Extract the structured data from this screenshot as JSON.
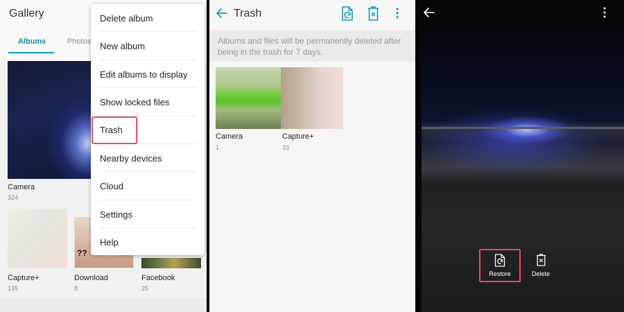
{
  "gallery": {
    "title": "Gallery",
    "tabs": [
      {
        "label": "Albums",
        "active": true
      },
      {
        "label": "Photos",
        "active": false
      }
    ],
    "albums": [
      {
        "name": "Camera",
        "count": "324"
      },
      {
        "name": "Capture+",
        "count": "135"
      },
      {
        "name": "Download",
        "count": "8"
      },
      {
        "name": "Facebook",
        "count": "25"
      }
    ],
    "menu": {
      "items": [
        {
          "label": "Delete album"
        },
        {
          "label": "New album"
        },
        {
          "label": "Edit albums to display"
        },
        {
          "label": "Show locked files"
        },
        {
          "label": "Trash",
          "highlighted": true
        },
        {
          "label": "Nearby devices"
        },
        {
          "label": "Cloud"
        },
        {
          "label": "Settings"
        },
        {
          "label": "Help"
        }
      ]
    }
  },
  "trash": {
    "title": "Trash",
    "notice": "Albums and files will be permanently deleted after being in the trash for 7 days.",
    "albums": [
      {
        "name": "Camera",
        "count": "1"
      },
      {
        "name": "Capture+",
        "count": "33"
      }
    ],
    "icons": [
      "restore-icon",
      "delete-icon",
      "more-icon"
    ]
  },
  "viewer": {
    "actions": [
      {
        "label": "Restore",
        "icon": "restore-icon",
        "highlighted": true
      },
      {
        "label": "Delete",
        "icon": "delete-icon"
      }
    ]
  },
  "colors": {
    "accent": "#0f9cb2",
    "highlight": "#e3505c"
  }
}
